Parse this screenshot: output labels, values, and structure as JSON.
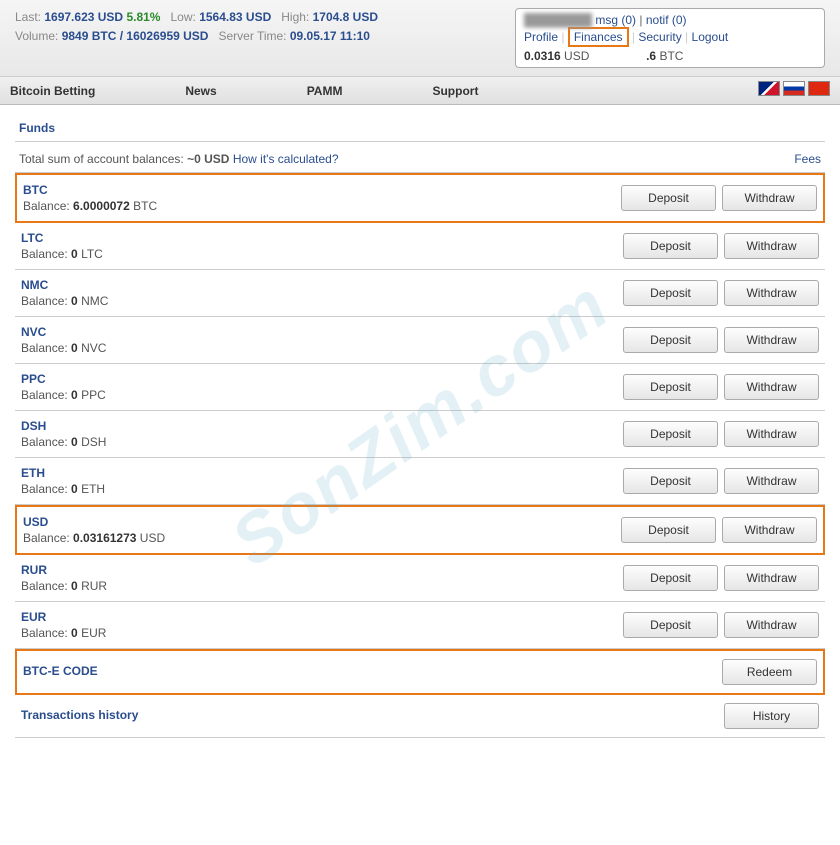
{
  "topbar": {
    "last_label": "Last:",
    "last_value": "1697.623 USD",
    "change": "5.81%",
    "low_label": "Low:",
    "low_value": "1564.83 USD",
    "high_label": "High:",
    "high_value": "1704.8 USD",
    "volume_label": "Volume:",
    "volume_value": "9849 BTC / 16026959 USD",
    "server_label": "Server Time:",
    "server_value": "09.05.17 11:10"
  },
  "userbox": {
    "msg": "msg (0)",
    "notif": "notif (0)",
    "profile": "Profile",
    "finances": "Finances",
    "security": "Security",
    "logout": "Logout",
    "bal_usd_val": "0.0316",
    "bal_usd_unit": "USD",
    "bal_btc_val": ".6",
    "bal_btc_unit": "BTC"
  },
  "nav": {
    "betting": "Bitcoin Betting",
    "news": "News",
    "pamm": "PAMM",
    "support": "Support"
  },
  "funds": {
    "title": "Funds",
    "summary_text": "Total sum of account balances:",
    "summary_value": "~0 USD",
    "summary_link": "How it's calculated?",
    "fees": "Fees",
    "balance_label": "Balance:",
    "deposit": "Deposit",
    "withdraw": "Withdraw",
    "redeem": "Redeem",
    "history": "History",
    "rows": [
      {
        "cur": "BTC",
        "bal": "6.0000072",
        "unit": "BTC",
        "highlight": true
      },
      {
        "cur": "LTC",
        "bal": "0",
        "unit": "LTC",
        "highlight": false
      },
      {
        "cur": "NMC",
        "bal": "0",
        "unit": "NMC",
        "highlight": false
      },
      {
        "cur": "NVC",
        "bal": "0",
        "unit": "NVC",
        "highlight": false
      },
      {
        "cur": "PPC",
        "bal": "0",
        "unit": "PPC",
        "highlight": false
      },
      {
        "cur": "DSH",
        "bal": "0",
        "unit": "DSH",
        "highlight": false
      },
      {
        "cur": "ETH",
        "bal": "0",
        "unit": "ETH",
        "highlight": false
      },
      {
        "cur": "USD",
        "bal": "0.03161273",
        "unit": "USD",
        "highlight": true
      },
      {
        "cur": "RUR",
        "bal": "0",
        "unit": "RUR",
        "highlight": false
      },
      {
        "cur": "EUR",
        "bal": "0",
        "unit": "EUR",
        "highlight": false
      }
    ],
    "code_row": {
      "label": "BTC-E CODE"
    },
    "history_row": {
      "label": "Transactions history"
    }
  },
  "watermark": "SonZim.com"
}
